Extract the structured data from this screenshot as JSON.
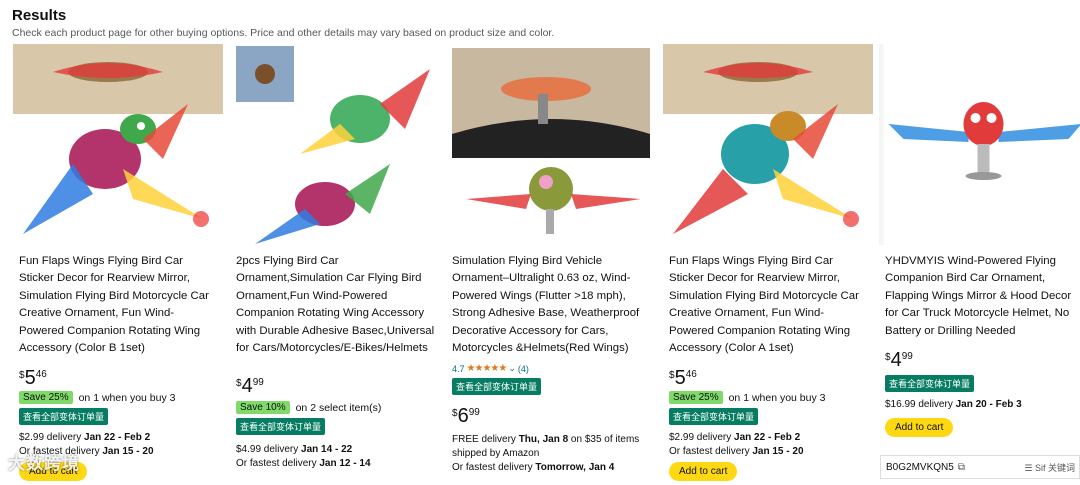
{
  "header": {
    "title": "Results",
    "subtitle": "Check each product page for other buying options. Price and other details may vary based on product size and color."
  },
  "cards": [
    {
      "title": "Fun Flaps Wings Flying Bird Car Sticker Decor for Rearview Mirror, Simulation Flying Bird Motorcycle Car Creative Ornament, Fun Wind-Powered Companion Rotating Wing Accessory (Color B 1set)",
      "price": {
        "symbol": "$",
        "whole": "5",
        "fraction": "46"
      },
      "save_badge": "Save 25%",
      "save_text": "on 1 when you buy 3",
      "variant_button": "查看全部变体订单量",
      "delivery_pre": "$2.99 delivery ",
      "delivery_date": "Jan 22 - Feb 2",
      "fastest_pre": "Or fastest delivery ",
      "fastest_date": "Jan 15 - 20",
      "add_to_cart": "Add to cart"
    },
    {
      "title": "2pcs Flying Bird Car Ornament,Simulation Car Flying Bird Ornament,Fun Wind-Powered Companion Rotating Wing Accessory with Durable Adhesive Basec,Universal for Cars/Motorcycles/E-Bikes/Helmets",
      "price": {
        "symbol": "$",
        "whole": "4",
        "fraction": "99"
      },
      "save_badge": "Save 10%",
      "save_text": "on 2 select item(s)",
      "variant_button": "查看全部变体订单量",
      "delivery_pre": "$4.99 delivery ",
      "delivery_date": "Jan 14 - 22",
      "fastest_pre": "Or fastest delivery ",
      "fastest_date": "Jan 12 - 14"
    },
    {
      "title": "Simulation Flying Bird Vehicle Ornament–Ultralight 0.63 oz, Wind-Powered Wings (Flutter >18 mph), Strong Adhesive Base, Weatherproof Decorative Accessory for Cars, Motorcycles &Helmets(Red Wings)",
      "rating_value": "4.7",
      "rating_count": "(4)",
      "variant_button": "查看全部变体订单量",
      "price": {
        "symbol": "$",
        "whole": "6",
        "fraction": "99"
      },
      "delivery_pre": "FREE delivery ",
      "delivery_date": "Thu, Jan 8",
      "delivery_post": " on $35 of items shipped by Amazon",
      "fastest_pre": "Or fastest delivery ",
      "fastest_date": "Tomorrow, Jan 4"
    },
    {
      "title": "Fun Flaps Wings Flying Bird Car Sticker Decor for Rearview Mirror, Simulation Flying Bird Motorcycle Car Creative Ornament, Fun Wind-Powered Companion Rotating Wing Accessory (Color A 1set)",
      "price": {
        "symbol": "$",
        "whole": "5",
        "fraction": "46"
      },
      "save_badge": "Save 25%",
      "save_text": "on 1 when you buy 3",
      "variant_button": "查看全部变体订单量",
      "delivery_pre": "$2.99 delivery ",
      "delivery_date": "Jan 22 - Feb 2",
      "fastest_pre": "Or fastest delivery ",
      "fastest_date": "Jan 15 - 20",
      "add_to_cart": "Add to cart"
    },
    {
      "title": "YHDVMYIS Wind-Powered Flying Companion Bird Car Ornament, Flapping Wings Mirror & Hood Decor for Car Truck Motorcycle Helmet, No Battery or Drilling Needed",
      "price": {
        "symbol": "$",
        "whole": "4",
        "fraction": "99"
      },
      "variant_button": "查看全部变体订单量",
      "delivery_pre": "$16.99 delivery ",
      "delivery_date": "Jan 20 - Feb 3",
      "add_to_cart": "Add to cart"
    }
  ],
  "asin_bar": {
    "asin": "B0G2MVKQN5",
    "copy_icon": "copy-icon",
    "tools": "☰ Sif 关键词"
  },
  "watermark": "大数跨境",
  "colors": {
    "save_badge": "#7fda69",
    "variant_button": "#067d62",
    "add_to_cart": "#ffd814",
    "link": "#007185",
    "star": "#de7921"
  }
}
